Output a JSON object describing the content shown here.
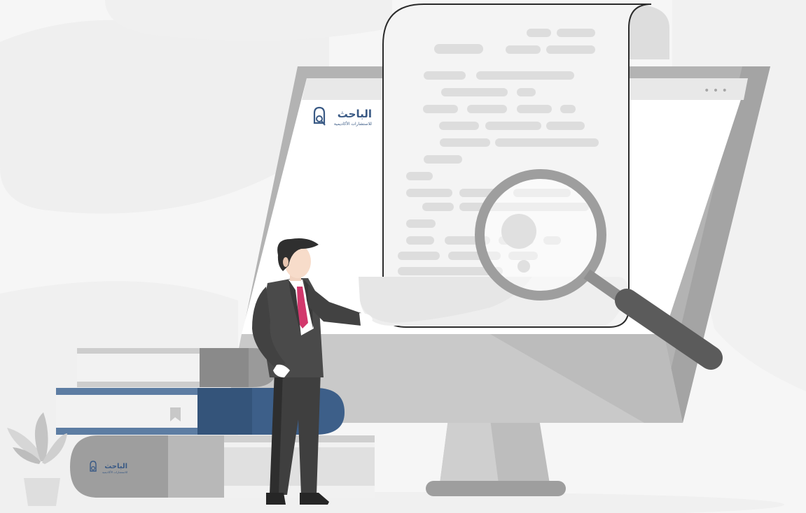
{
  "monitor": {
    "window_dots": "• • •",
    "logo": {
      "name": "الباحث",
      "tagline": "للاستشارات الأكاديمية"
    }
  },
  "books": {
    "logo": {
      "name": "الباحث",
      "tagline": "للاستشارات الأكاديمية"
    }
  },
  "colors": {
    "background": "#f6f6f6",
    "monitor_frame": "#b3b3b3",
    "paper": "#f4f4f4",
    "brand_blue": "#3a5a85",
    "tie": "#d2386c",
    "suit": "#3f3f3f"
  }
}
